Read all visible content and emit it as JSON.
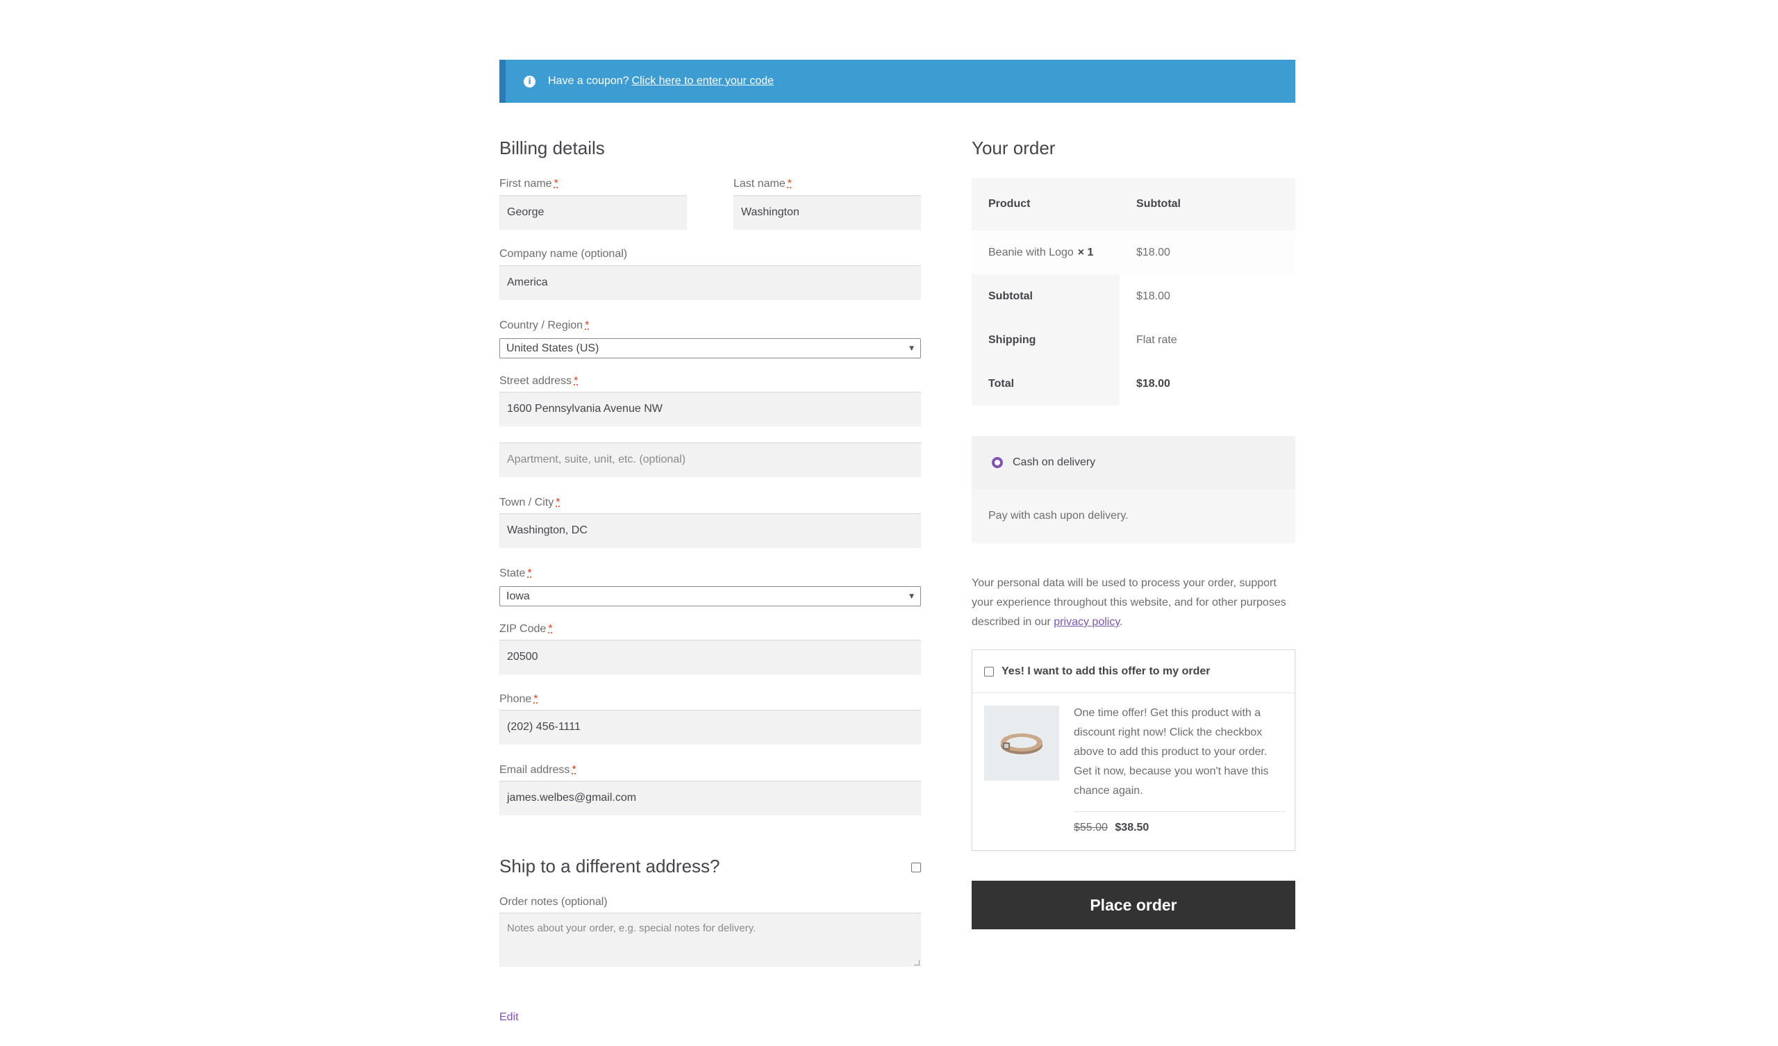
{
  "coupon": {
    "info_icon": "info-icon",
    "text": "Have a coupon?",
    "link": "Click here to enter your code",
    "color": "#3d9cd2"
  },
  "billing": {
    "title": "Billing details",
    "required_mark": "*",
    "first_name": {
      "label": "First name",
      "value": "George"
    },
    "last_name": {
      "label": "Last name",
      "value": "Washington"
    },
    "company": {
      "label": "Company name (optional)",
      "value": "America"
    },
    "country": {
      "label": "Country / Region",
      "value": "United States (US)"
    },
    "street": {
      "label": "Street address",
      "value": "1600 Pennsylvania Avenue NW",
      "placeholder2": "Apartment, suite, unit, etc. (optional)"
    },
    "city": {
      "label": "Town / City",
      "value": "Washington, DC"
    },
    "state": {
      "label": "State",
      "value": "Iowa"
    },
    "zip": {
      "label": "ZIP Code",
      "value": "20500"
    },
    "phone": {
      "label": "Phone",
      "value": "(202) 456-1111"
    },
    "email": {
      "label": "Email address",
      "value": "james.welbes@gmail.com"
    }
  },
  "shipping": {
    "title": "Ship to a different address?",
    "notes_label": "Order notes (optional)",
    "notes_placeholder": "Notes about your order, e.g. special notes for delivery."
  },
  "edit_link": "Edit",
  "order": {
    "title": "Your order",
    "col_product": "Product",
    "col_subtotal": "Subtotal",
    "item_name": "Beanie with Logo",
    "item_qty": "× 1",
    "item_price": "$18.00",
    "subtotal_label": "Subtotal",
    "subtotal_value": "$18.00",
    "shipping_label": "Shipping",
    "shipping_value": "Flat rate",
    "total_label": "Total",
    "total_value": "$18.00"
  },
  "payment": {
    "method": "Cash on delivery",
    "description": "Pay with cash upon delivery.",
    "accent": "#7f54b3"
  },
  "privacy": {
    "text": "Your personal data will be used to process your order, support your experience throughout this website, and for other purposes described in our",
    "link": "privacy policy",
    "end": "."
  },
  "offer": {
    "checkbox_label": "Yes! I want to add this offer to my order",
    "description": "One time offer! Get this product with a discount right now! Click the checkbox above to add this product to your order. Get it now, because you won't have this chance again.",
    "old_price": "$55.00",
    "new_price": "$38.50",
    "image_icon": "belt-image"
  },
  "place_order": "Place order"
}
